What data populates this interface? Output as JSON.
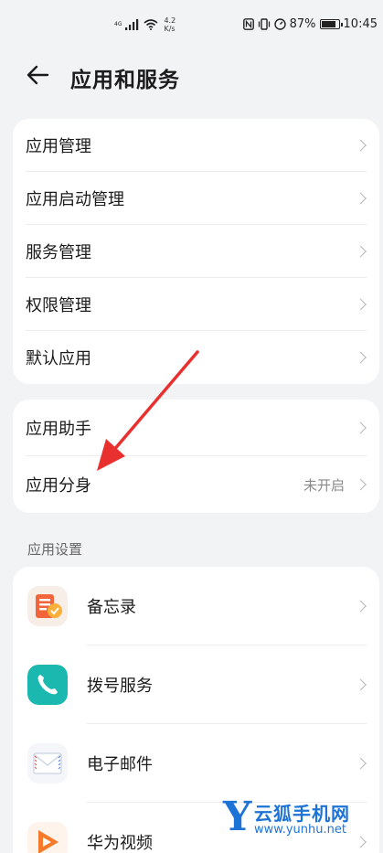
{
  "status_bar": {
    "network": "4G",
    "speed_value": "4.2",
    "speed_unit": "K/s",
    "battery": "87%",
    "time": "10:45"
  },
  "header": {
    "title": "应用和服务"
  },
  "card1": {
    "items": [
      {
        "label": "应用管理"
      },
      {
        "label": "应用启动管理"
      },
      {
        "label": "服务管理"
      },
      {
        "label": "权限管理"
      },
      {
        "label": "默认应用"
      }
    ]
  },
  "card2": {
    "items": [
      {
        "label": "应用助手",
        "value": ""
      },
      {
        "label": "应用分身",
        "value": "未开启"
      }
    ]
  },
  "app_settings": {
    "section_title": "应用设置",
    "items": [
      {
        "label": "备忘录",
        "icon": "notepad-icon",
        "color": "#f2653a"
      },
      {
        "label": "拨号服务",
        "icon": "phone-icon",
        "color": "#1bb8b0"
      },
      {
        "label": "电子邮件",
        "icon": "mail-icon",
        "color": "#e8eef6"
      },
      {
        "label": "华为视频",
        "icon": "video-icon",
        "color": "#f57b2a"
      }
    ]
  },
  "watermark": {
    "letter": "Y",
    "name": "云狐手机网",
    "url": "www.yunhu.net"
  }
}
